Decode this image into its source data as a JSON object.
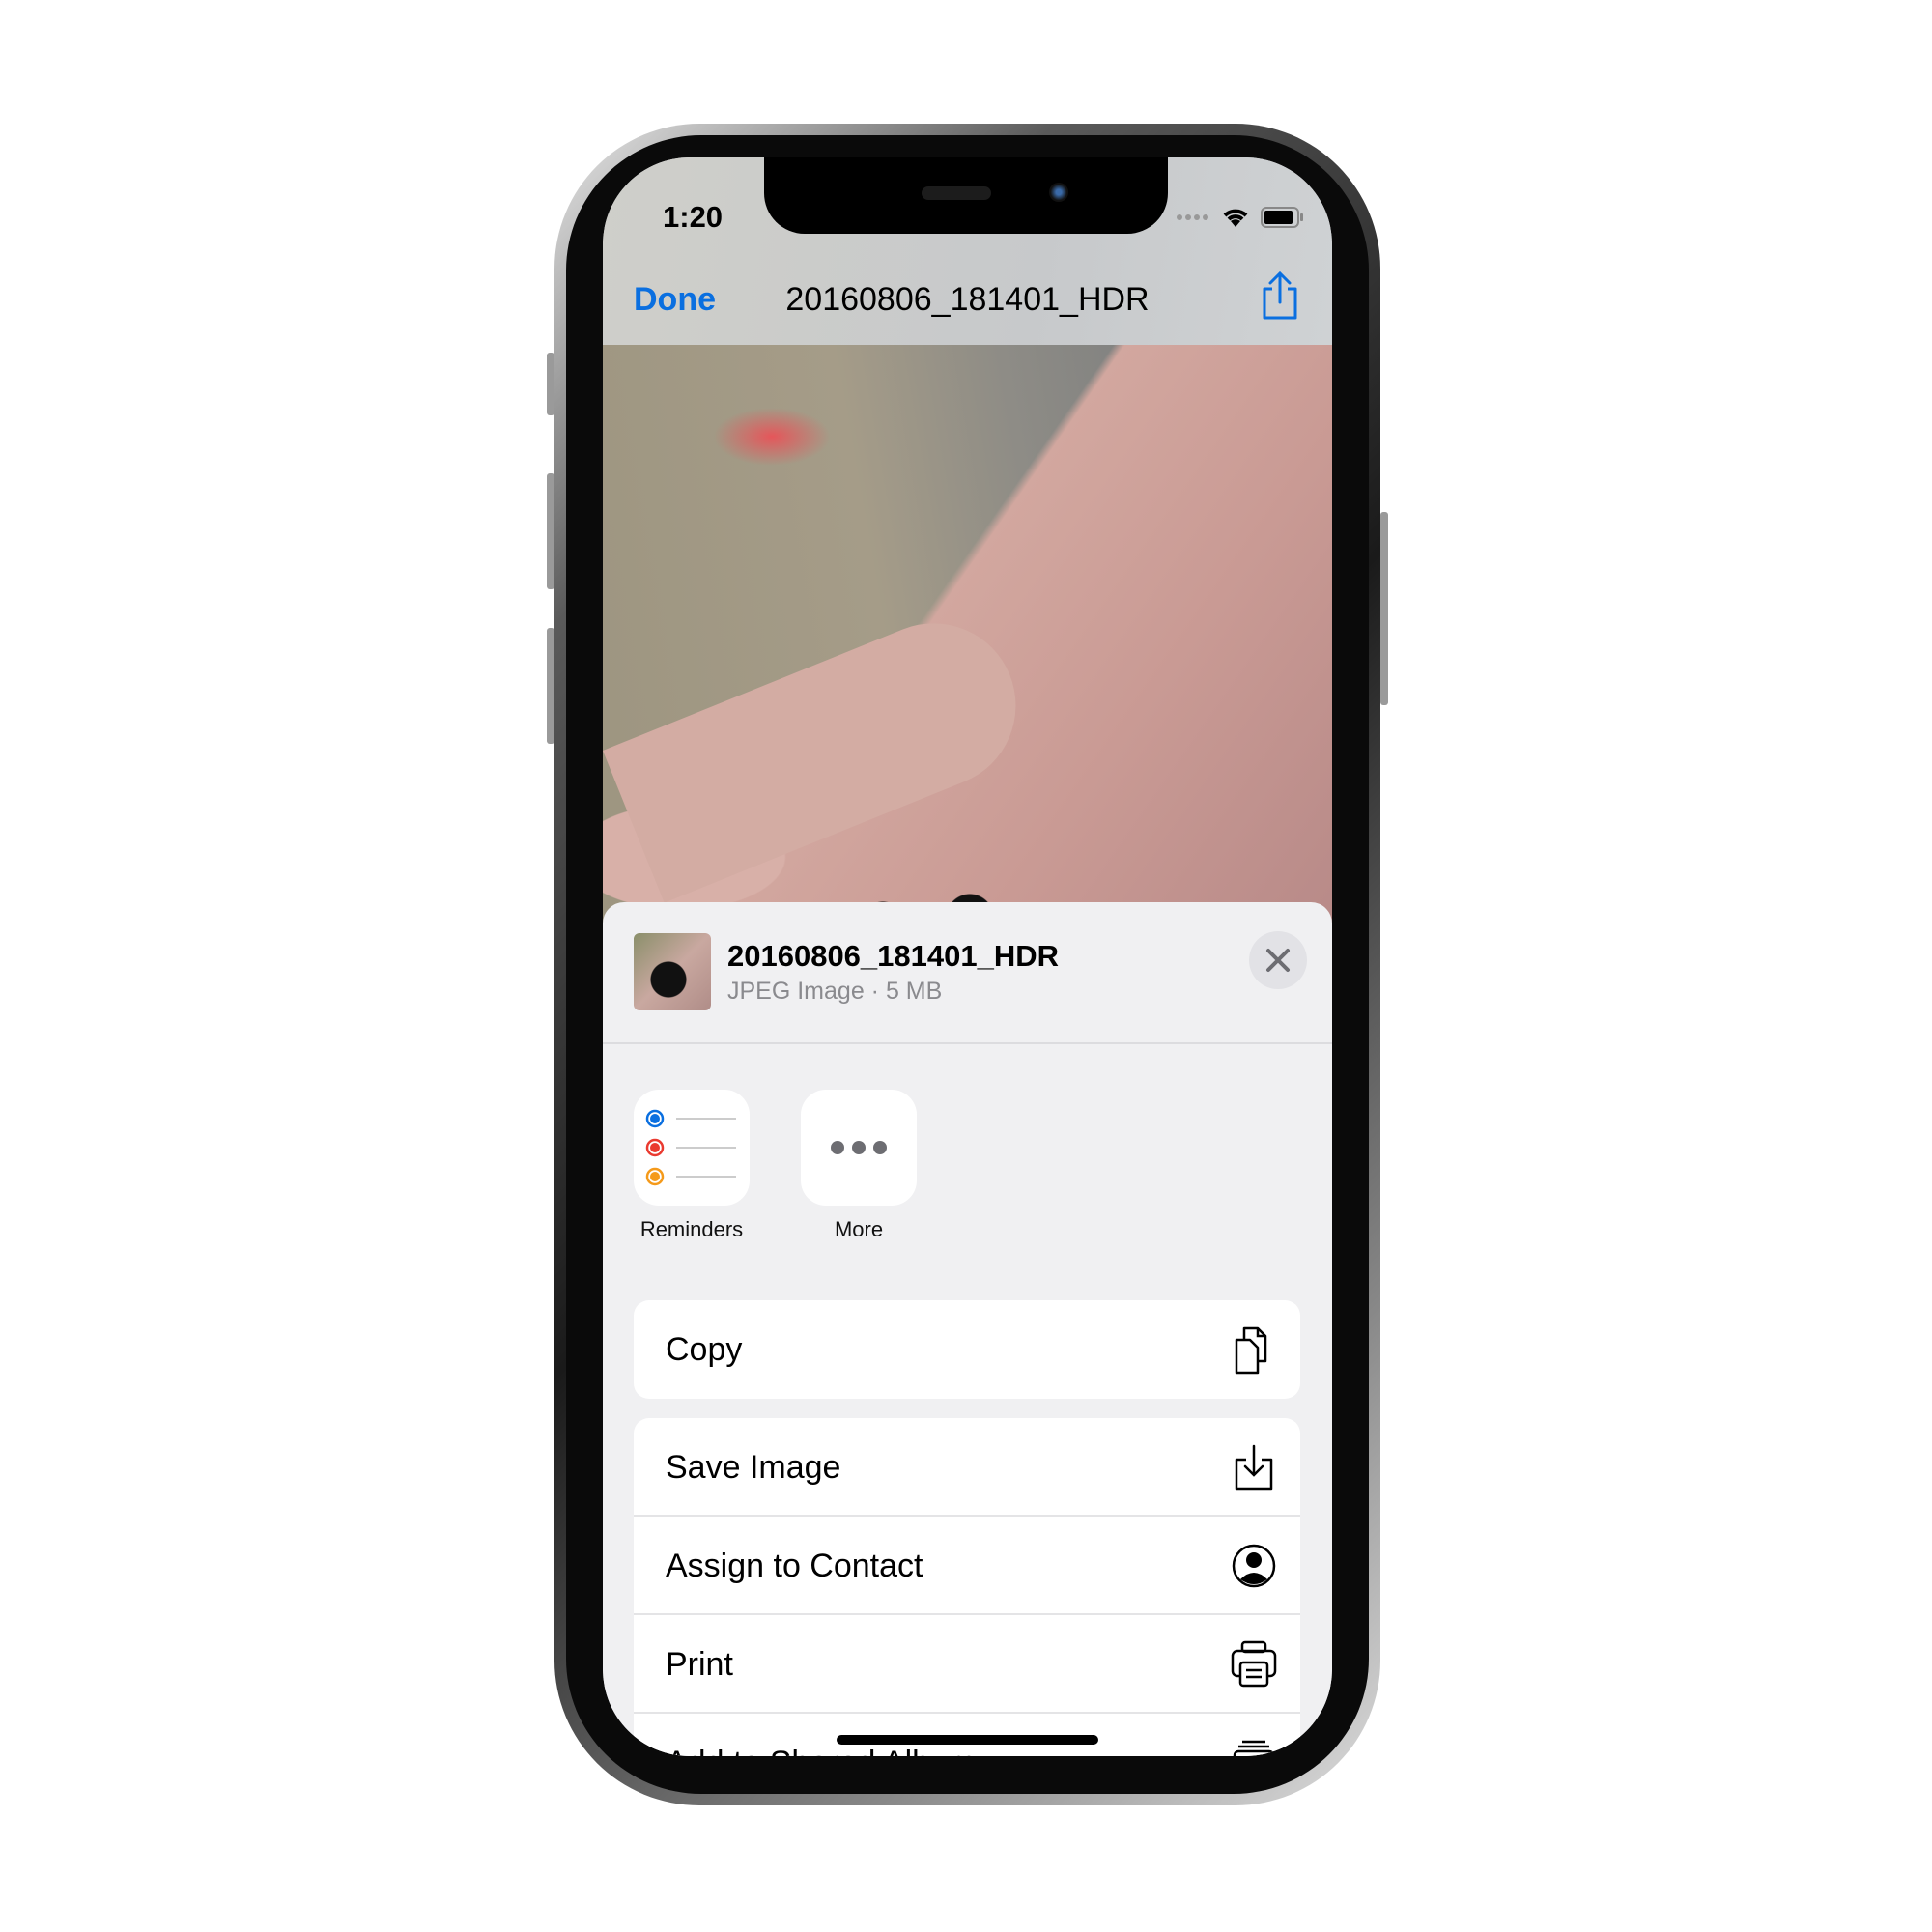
{
  "status_bar": {
    "time": "1:20",
    "icons": [
      "signal-dots-icon",
      "wifi-icon",
      "battery-icon"
    ]
  },
  "nav": {
    "done_label": "Done",
    "title": "20160806_181401_HDR",
    "share_icon": "share-icon"
  },
  "sheet": {
    "file_title": "20160806_181401_HDR",
    "file_subtitle": "JPEG Image · 5 MB",
    "apps": [
      {
        "label": "Reminders",
        "icon": "reminders-icon"
      },
      {
        "label": "More",
        "icon": "more-icon"
      }
    ],
    "actions_group1": [
      {
        "label": "Copy",
        "icon": "copy-icon"
      }
    ],
    "actions_group2": [
      {
        "label": "Save Image",
        "icon": "save-icon"
      },
      {
        "label": "Assign to Contact",
        "icon": "contact-icon"
      },
      {
        "label": "Print",
        "icon": "print-icon"
      },
      {
        "label": "Add to Shared Album",
        "icon": "shared-album-icon"
      }
    ]
  },
  "colors": {
    "accent": "#0a6fe0",
    "sheet_bg": "#f0f0f2"
  }
}
